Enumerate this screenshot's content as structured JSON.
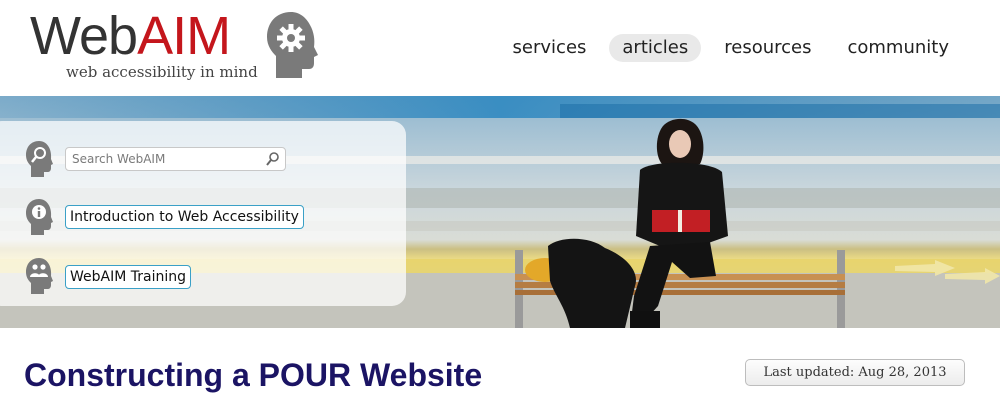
{
  "logo": {
    "word_web": "Web",
    "word_aim": "AIM",
    "tagline": "web accessibility in mind",
    "icon": "gear-head-logo"
  },
  "nav": {
    "items": [
      {
        "label": "services",
        "active": false
      },
      {
        "label": "articles",
        "active": true
      },
      {
        "label": "resources",
        "active": false
      },
      {
        "label": "community",
        "active": false
      }
    ]
  },
  "banner": {
    "photo_icon": "woman-reading-on-bench-photo",
    "search": {
      "placeholder": "Search WebAIM",
      "value": "",
      "icon": "magnifier-icon",
      "row_icon": "search-head-icon"
    },
    "links": [
      {
        "label": "Introduction to Web Accessibility",
        "icon": "info-head-icon"
      },
      {
        "label": "WebAIM Training",
        "icon": "people-head-icon"
      }
    ]
  },
  "content": {
    "title": "Constructing a POUR Website",
    "last_updated": "Last updated: Aug 28, 2013"
  },
  "colors": {
    "brand_red": "#c4161c",
    "title_navy": "#1b1464",
    "link_border": "#3aa0c7",
    "nav_active_bg": "#e9e9e9"
  }
}
